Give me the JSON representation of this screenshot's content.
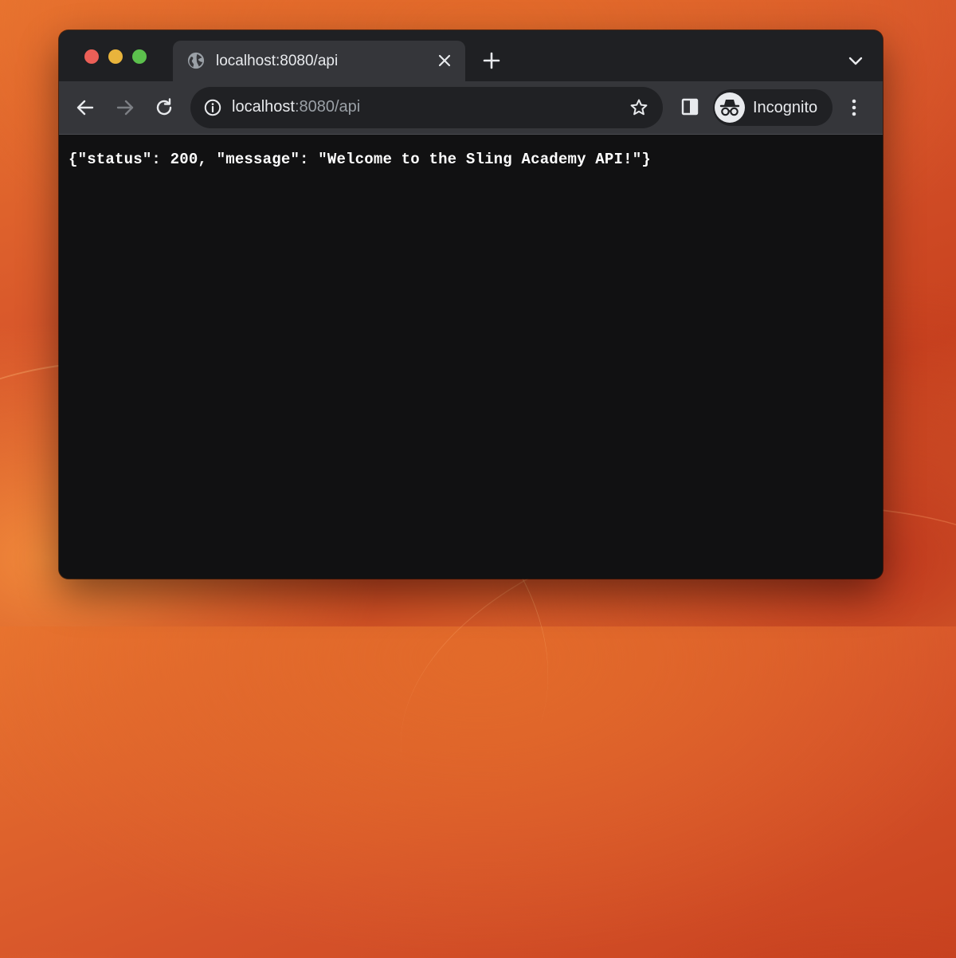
{
  "tab": {
    "title": "localhost:8080/api",
    "favicon": "globe-icon"
  },
  "address_bar": {
    "host": "localhost",
    "rest": ":8080/api"
  },
  "profile": {
    "label": "Incognito",
    "icon": "incognito-icon"
  },
  "page": {
    "body_text": "{\"status\": 200, \"message\": \"Welcome to the Sling Academy API!\"}"
  },
  "colors": {
    "tab_strip": "#1f2023",
    "toolbar": "#35363a",
    "omnibox": "#202124",
    "content_bg": "#111112",
    "close_dot": "#ec5f57",
    "minimize_dot": "#e9b43c",
    "zoom_dot": "#5cc04d"
  }
}
